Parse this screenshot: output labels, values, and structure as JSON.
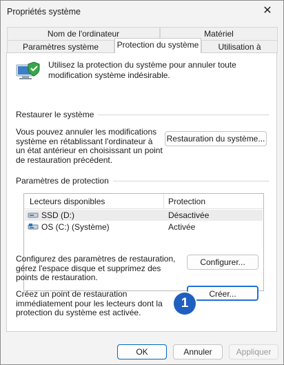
{
  "window": {
    "title": "Propriétés système",
    "close_glyph": "✕"
  },
  "tabs": {
    "row1": [
      "Nom de l'ordinateur",
      "Matériel"
    ],
    "row2": [
      "Paramètres système avancés",
      "Protection du système",
      "Utilisation à distance"
    ],
    "active": "Protection du système"
  },
  "intro": "Utilisez la protection du système pour annuler toute modification système indésirable.",
  "restore": {
    "label": "Restaurer le système",
    "text": "Vous pouvez annuler les modifications système en rétablissant l'ordinateur à un état antérieur en choisissant un point de restauration précédent.",
    "button": "Restauration du système..."
  },
  "protection": {
    "label": "Paramètres de protection",
    "columns": [
      "Lecteurs disponibles",
      "Protection"
    ],
    "drives": [
      {
        "name": "SSD (D:)",
        "status": "Désactivée",
        "icon": "drive-icon"
      },
      {
        "name": "OS (C:) (Système)",
        "status": "Activée",
        "icon": "system-drive-icon"
      }
    ],
    "configure_text": "Configurez des paramètres de restauration, gérez l'espace disque et supprimez des points de restauration.",
    "configure_button": "Configurer...",
    "create_text": "Créez un point de restauration immédiatement pour les lecteurs dont la protection du système est activée.",
    "create_button": "Créer..."
  },
  "step_marker": "1",
  "footer": {
    "ok": "OK",
    "cancel": "Annuler",
    "apply": "Appliquer"
  },
  "colors": {
    "accent": "#0067c0",
    "marker": "#1f5fbf",
    "highlight": "#1f6fd8"
  }
}
